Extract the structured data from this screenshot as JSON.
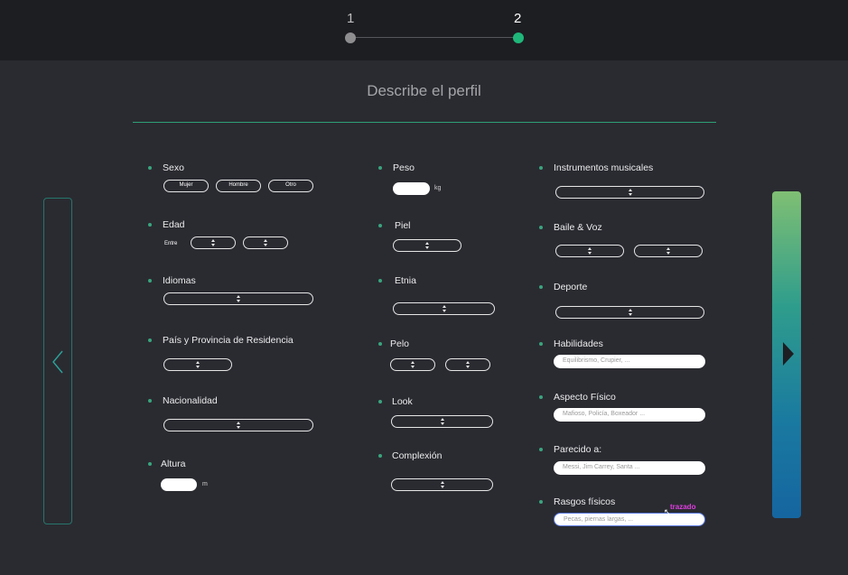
{
  "stepper": {
    "step1": "1",
    "step2": "2",
    "active_step": 2
  },
  "title": "Describe el perfil",
  "col1": {
    "sexo": {
      "label": "Sexo",
      "options": [
        "Mujer",
        "Hombre",
        "Otro"
      ]
    },
    "edad": {
      "label": "Edad",
      "between": "Entre"
    },
    "idiomas": {
      "label": "Idiomas"
    },
    "pais": {
      "label": "País y Provincia de Residencia"
    },
    "nacionalidad": {
      "label": "Nacionalidad"
    },
    "altura": {
      "label": "Altura",
      "unit": "m"
    }
  },
  "col2": {
    "peso": {
      "label": "Peso",
      "unit": "kg"
    },
    "piel": {
      "label": "Piel"
    },
    "etnia": {
      "label": "Etnia"
    },
    "pelo": {
      "label": "Pelo"
    },
    "look": {
      "label": "Look"
    },
    "complexion": {
      "label": "Complexión"
    }
  },
  "col3": {
    "instrumentos": {
      "label": "Instrumentos musicales"
    },
    "baile": {
      "label": "Baile & Voz"
    },
    "deporte": {
      "label": "Deporte"
    },
    "habilidades": {
      "label": "Habilidades",
      "placeholder": "Equilibrismo, Crupier, ..."
    },
    "aspecto": {
      "label": "Aspecto Físico",
      "placeholder": "Mafioso, Policía, Boxeador ..."
    },
    "parecido": {
      "label": "Parecido a:",
      "placeholder": "Messi, Jim Carrey, Santa ..."
    },
    "rasgos": {
      "label": "Rasgos físicos",
      "placeholder": "Pecas, piernas largas, ..."
    }
  },
  "annotation": "trazado",
  "icons": {
    "prev": "chevron-left-icon",
    "next": "play-triangle-icon"
  },
  "colors": {
    "accent": "#1fb77a",
    "background": "#2a2b31",
    "topbar": "#1d1e22"
  }
}
